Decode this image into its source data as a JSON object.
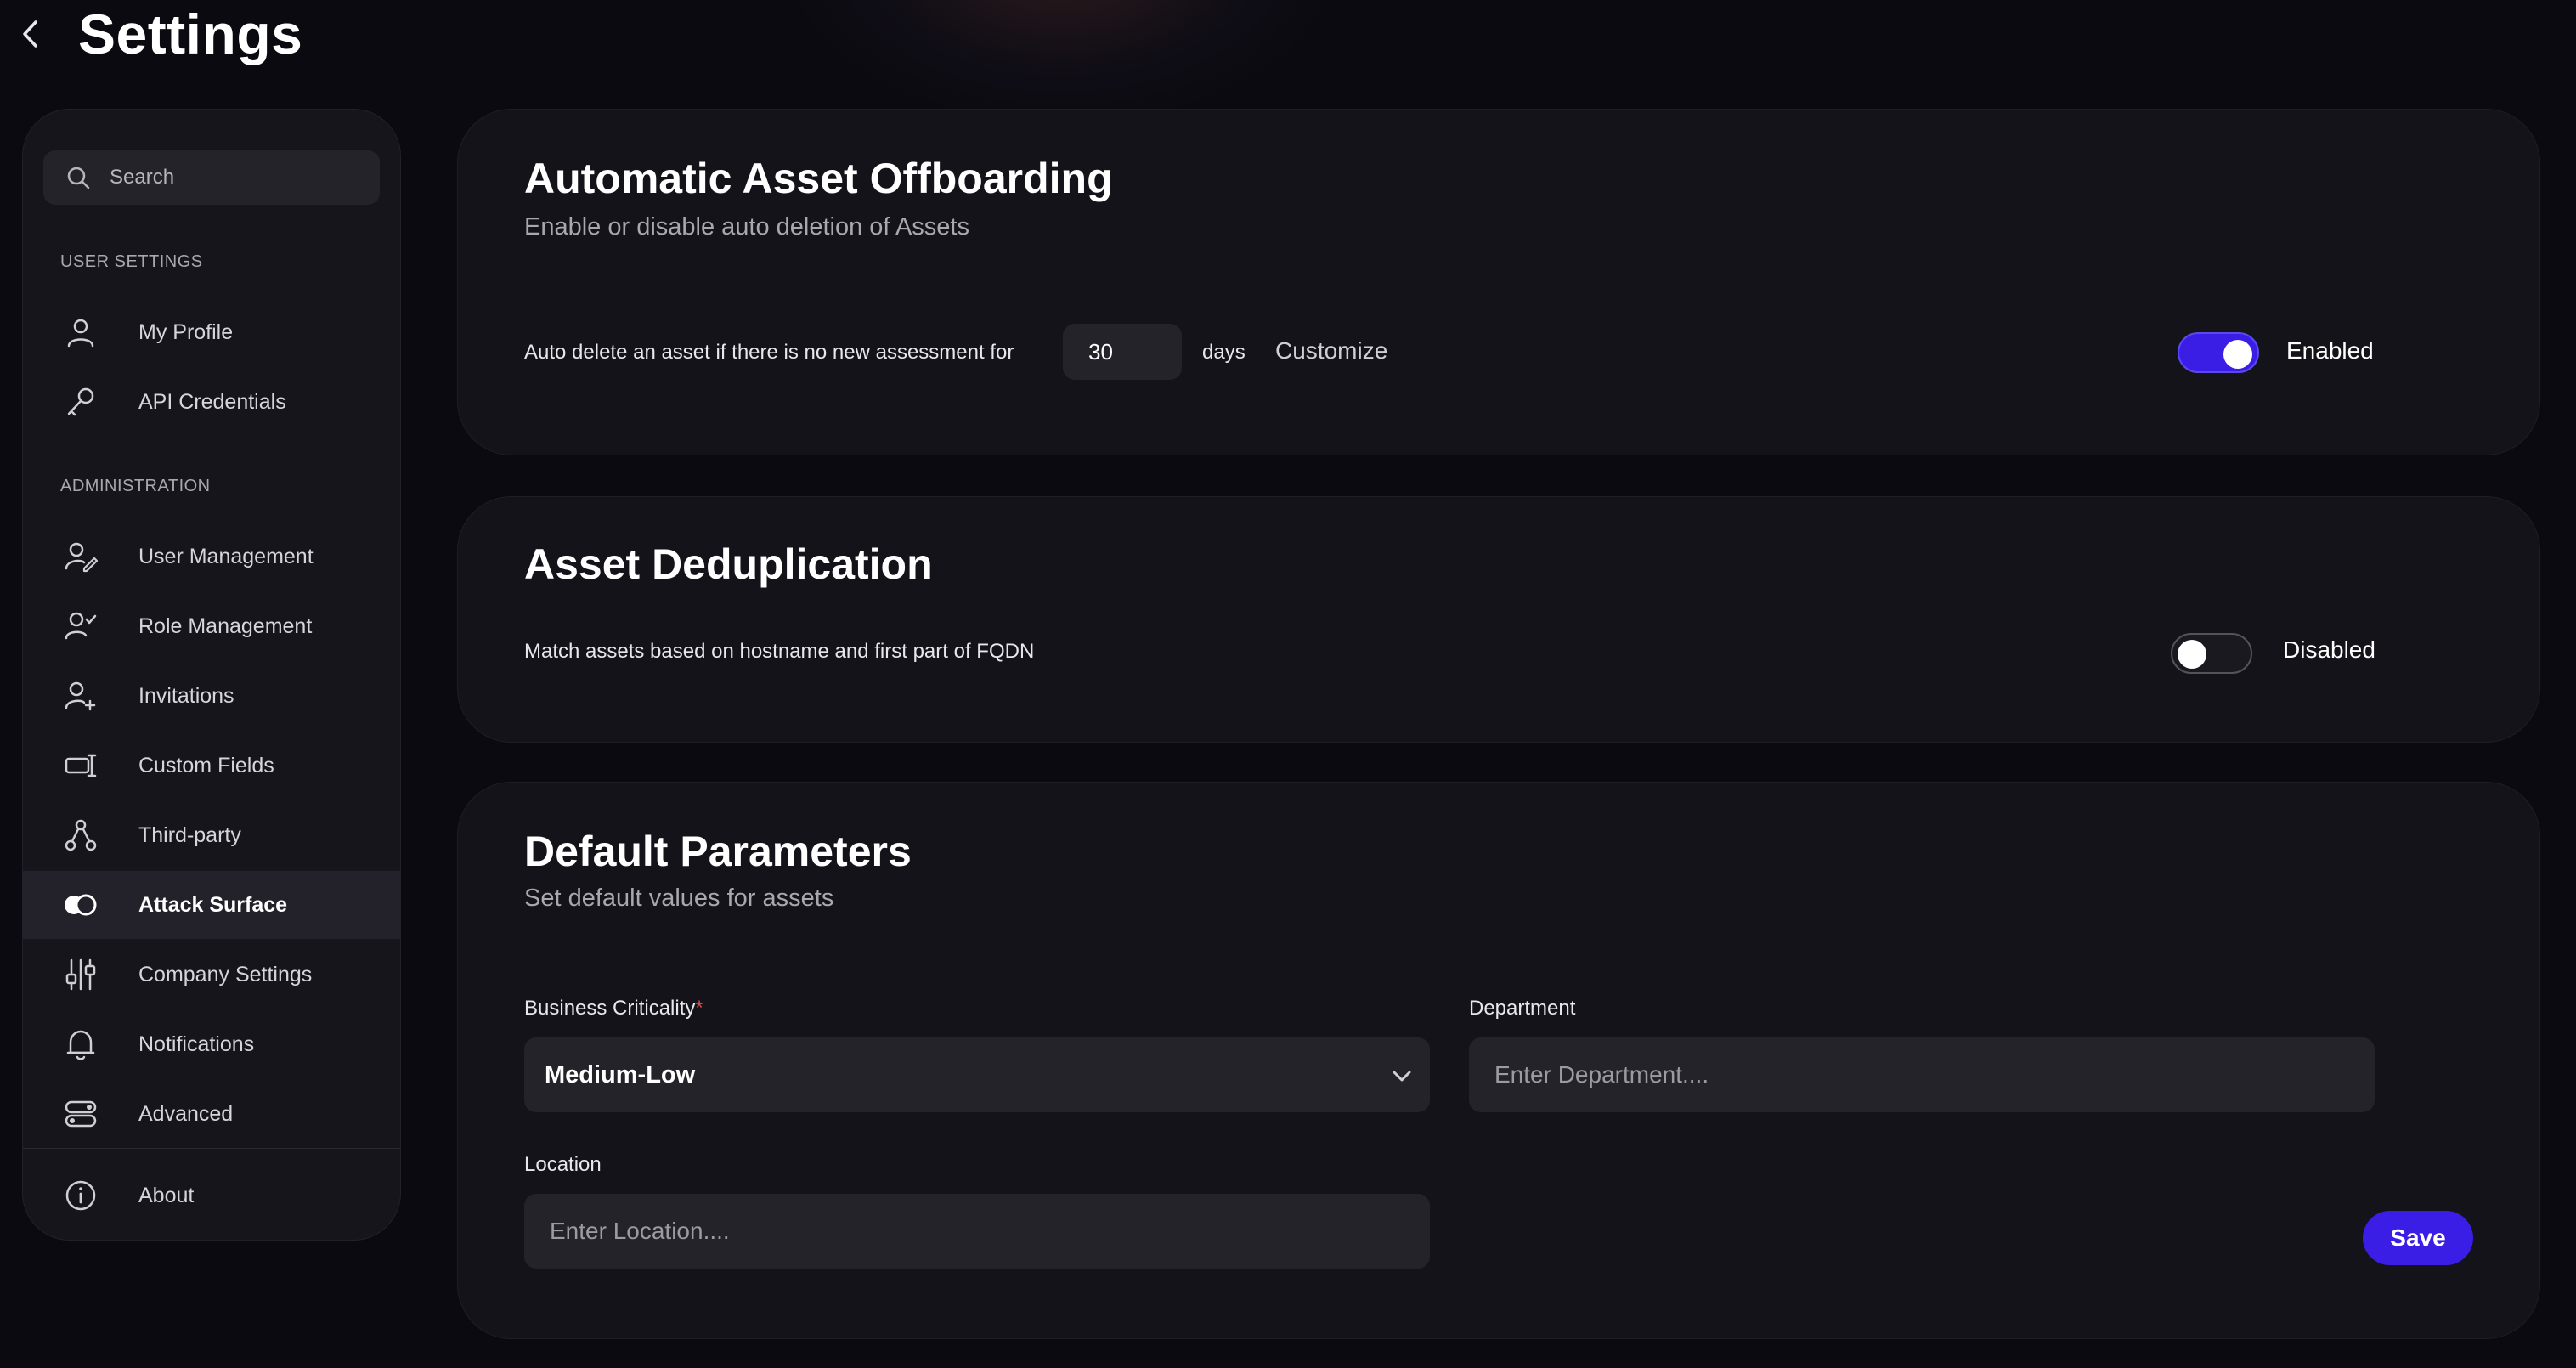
{
  "header": {
    "title": "Settings"
  },
  "sidebar": {
    "search_placeholder": "Search",
    "sections": {
      "user_settings": "USER SETTINGS",
      "administration": "ADMINISTRATION"
    },
    "items": [
      {
        "label": "My Profile",
        "icon": "user-icon"
      },
      {
        "label": "API Credentials",
        "icon": "key-icon"
      },
      {
        "label": "User Management",
        "icon": "user-edit-icon"
      },
      {
        "label": "Role Management",
        "icon": "user-check-icon"
      },
      {
        "label": "Invitations",
        "icon": "user-plus-icon"
      },
      {
        "label": "Custom Fields",
        "icon": "custom-fields-icon"
      },
      {
        "label": "Third-party",
        "icon": "third-party-icon"
      },
      {
        "label": "Attack Surface",
        "icon": "attack-surface-icon",
        "active": true
      },
      {
        "label": "Company Settings",
        "icon": "sliders-icon"
      },
      {
        "label": "Notifications",
        "icon": "bell-icon"
      },
      {
        "label": "Advanced",
        "icon": "toggles-icon"
      },
      {
        "label": "About",
        "icon": "info-icon"
      }
    ]
  },
  "offboarding": {
    "title": "Automatic Asset Offboarding",
    "subtitle": "Enable or disable auto deletion of Assets",
    "rule_text": "Auto delete an asset if there is no new assessment for",
    "days_value": "30",
    "days_label": "days",
    "customize_label": "Customize",
    "toggle_on": true,
    "status_label": "Enabled"
  },
  "dedup": {
    "title": "Asset Deduplication",
    "rule_text": "Match assets based on hostname and first part of FQDN",
    "toggle_on": false,
    "status_label": "Disabled"
  },
  "defaults": {
    "title": "Default Parameters",
    "subtitle": "Set default values for assets",
    "criticality_label": "Business Criticality",
    "required_mark": "*",
    "criticality_value": "Medium-Low",
    "department_label": "Department",
    "department_placeholder": "Enter Department....",
    "location_label": "Location",
    "location_placeholder": "Enter Location....",
    "save_label": "Save"
  },
  "colors": {
    "accent": "#3a1ee6",
    "background": "#0b0a10",
    "card": "#141319"
  }
}
